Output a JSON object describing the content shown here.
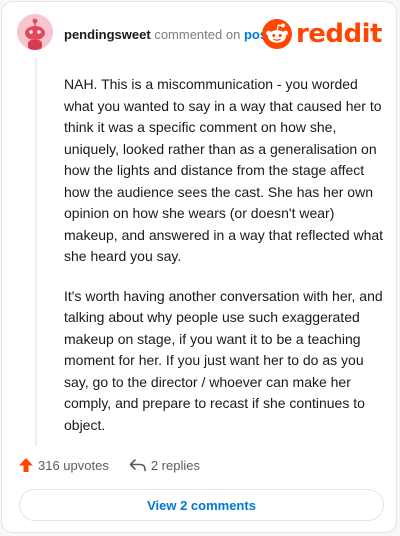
{
  "header": {
    "username": "pendingsweet",
    "action_text": "commented on",
    "post_link": "post",
    "brand_wordmark": "reddit",
    "brand_color": "#ff4500"
  },
  "comment": {
    "paragraphs": [
      "NAH. This is a miscommunication - you worded what you wanted to say in a way that caused her to think it was a specific comment on how she, uniquely, looked rather than as a generalisation on how the lights and distance from the stage affect how the audience sees the cast. She has her own opinion on how she wears (or doesn't wear) makeup, and answered in a way that reflected what she heard you say.",
      "It's worth having another conversation with her, and talking about why people use such exaggerated makeup on stage, if you want it to be a teaching moment for her. If you just want her to do as you say, go to the director / whoever can make her comply, and prepare to recast if she continues to object."
    ]
  },
  "actions": {
    "upvotes": "316 upvotes",
    "replies": "2 replies",
    "upvote_icon": "upvote-arrow-icon",
    "reply_icon": "reply-arrow-icon",
    "upvote_color": "#ff4500"
  },
  "footer": {
    "view_comments": "View 2 comments",
    "link_color": "#0079d3"
  }
}
